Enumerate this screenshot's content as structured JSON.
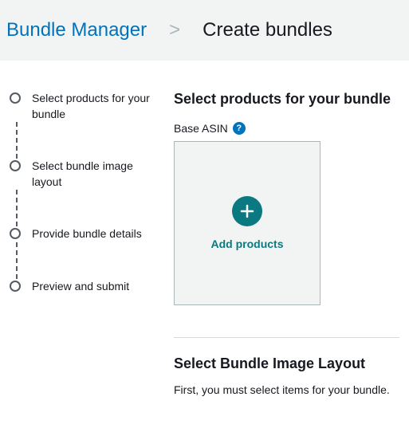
{
  "breadcrumb": {
    "link": "Bundle Manager",
    "separator": ">",
    "current": "Create bundles"
  },
  "stepper": {
    "steps": [
      {
        "label": "Select products for your bundle"
      },
      {
        "label": "Select bundle image layout"
      },
      {
        "label": "Provide bundle details"
      },
      {
        "label": "Preview and submit"
      }
    ]
  },
  "section1": {
    "heading": "Select products for your bundle",
    "field_label": "Base ASIN",
    "help_glyph": "?",
    "add_text": "Add products"
  },
  "section2": {
    "heading": "Select Bundle Image Layout",
    "note": "First, you must select items for your bundle."
  }
}
